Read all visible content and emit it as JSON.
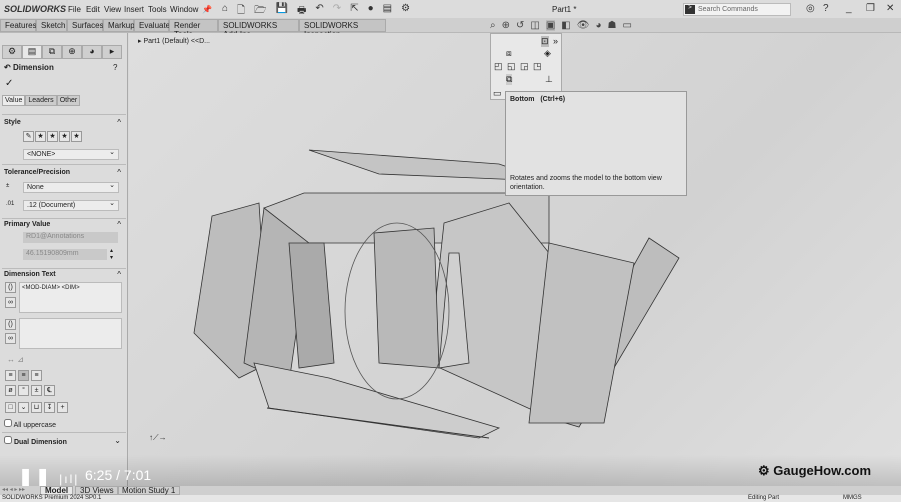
{
  "app": {
    "logo": "SOLIDWORKS",
    "document_title": "Part1 *"
  },
  "menu": [
    "File",
    "Edit",
    "View",
    "Insert",
    "Tools",
    "Window"
  ],
  "search": {
    "placeholder": "Search Commands"
  },
  "command_tabs": [
    "Features",
    "Sketch",
    "Surfaces",
    "Markup",
    "Evaluate",
    "Render Tools",
    "SOLIDWORKS Add-Ins",
    "SOLIDWORKS Inspection"
  ],
  "tree": {
    "root": "Part1 (Default) <<D..."
  },
  "property_manager": {
    "title": "Dimension",
    "tabs": [
      "Value",
      "Leaders",
      "Other"
    ],
    "style": {
      "header": "Style",
      "value": "<NONE>"
    },
    "tolerance": {
      "header": "Tolerance/Precision",
      "tolerance": "None",
      "precision": ".12 (Document)"
    },
    "primary_value": {
      "header": "Primary Value",
      "name": "RD1@Annotations",
      "value": "46.15190809mm"
    },
    "dimension_text": {
      "header": "Dimension Text",
      "text": "<MOD-DIAM> <DIM>"
    },
    "all_uppercase": "All uppercase",
    "dual_dimension": "Dual Dimension"
  },
  "tooltip": {
    "title": "Bottom",
    "shortcut": "(Ctrl+6)",
    "description": "Rotates and zooms the model to the bottom view orientation."
  },
  "video": {
    "time": "6:25 / 7:01",
    "watermark": "GaugeHow.com"
  },
  "bottom_tabs": [
    "Model",
    "3D Views",
    "Motion Study 1"
  ],
  "status": {
    "product": "SOLIDWORKS Premium 2024 SP0.1",
    "mode": "Editing Part",
    "units": "MMGS"
  }
}
